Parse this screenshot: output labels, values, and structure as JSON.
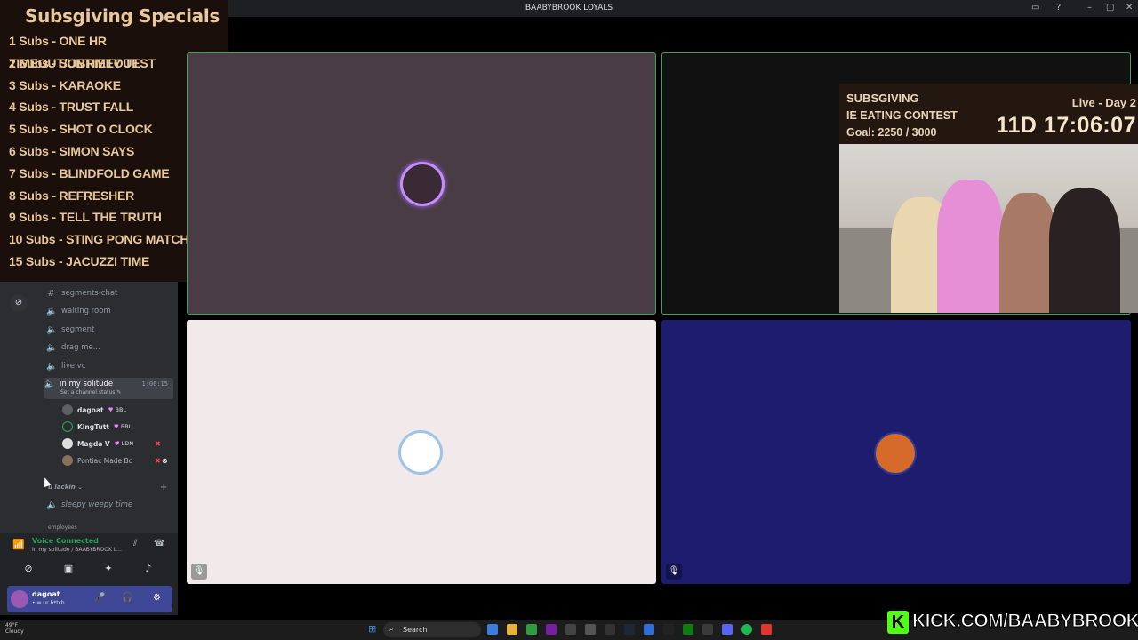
{
  "window": {
    "title": "BAABYBROOK LOYALS",
    "controls": [
      "▭",
      "?",
      "–",
      "▢",
      "✕"
    ]
  },
  "specials": {
    "title": "Subsgiving Specials",
    "items": [
      "1 Subs - ONE HR TIMEOUT/UNTIMEOUT",
      "2 Subs - SOBRIETY TEST",
      "3 Subs - KARAOKE",
      "4 Subs - TRUST FALL",
      "5 Subs - SHOT O CLOCK",
      "6 Subs - SIMON SAYS",
      "7 Subs - BLINDFOLD GAME",
      "8 Subs - REFRESHER",
      "9 Subs - TELL THE TRUTH",
      "10 Subs - STING PONG MATCH",
      "15 Subs - JACUZZI TIME"
    ]
  },
  "sidebar": {
    "channels": [
      {
        "icon": "hash-icon",
        "glyph": "#",
        "label": "segments-chat"
      },
      {
        "icon": "speaker-icon",
        "glyph": "🔊",
        "label": "waiting room"
      },
      {
        "icon": "speaker-icon",
        "glyph": "🔊",
        "label": "segment"
      },
      {
        "icon": "speaker-icon",
        "glyph": "🔊",
        "label": "drag me..."
      },
      {
        "icon": "speaker-icon",
        "glyph": "🔊",
        "label": "live vc"
      }
    ],
    "active_channel": {
      "label": "in my solitude",
      "status": "Set a channel status ✎",
      "timer": "1:06:15"
    },
    "users": [
      {
        "name": "dagoat",
        "tag": "BBL"
      },
      {
        "name": "KingTutt",
        "tag": "BBL"
      },
      {
        "name": "Magda V",
        "tag": "LDN"
      },
      {
        "name": "Pontiac Made Bo",
        "tag": ""
      }
    ],
    "category": {
      "label": "u lackin",
      "chevron": "⌄",
      "add": "+"
    },
    "after_channel": {
      "label": "sleepy weepy time"
    },
    "next_category": "employees"
  },
  "voice": {
    "status": "Voice Connected",
    "location": "in my solitude / BAABYBROOK L..."
  },
  "user_panel": {
    "name": "dagoat",
    "status": "• w ur b*tch"
  },
  "stream": {
    "event": "SUBSGIVING",
    "contest": "IE EATING CONTEST",
    "goal": "Goal: 2250 / 3000",
    "live": "Live - Day 2",
    "timer": "11D 17:06:07"
  },
  "taskbar": {
    "weather_temp": "49°F",
    "weather_cond": "Cloudy",
    "search": "Search"
  },
  "kick": {
    "logo": "K",
    "url": "KICK.COM/BAABYBROOK"
  }
}
